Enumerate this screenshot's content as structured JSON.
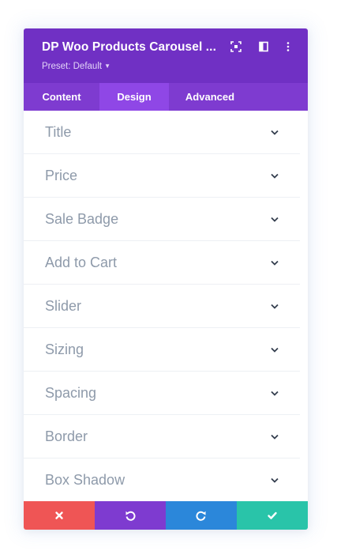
{
  "header": {
    "title": "DP Woo Products Carousel ...",
    "preset": "Preset: Default",
    "icons": [
      "focus-icon",
      "sidebar-layout-icon",
      "more-vertical-icon"
    ]
  },
  "tabs": [
    {
      "label": "Content",
      "active": false
    },
    {
      "label": "Design",
      "active": true
    },
    {
      "label": "Advanced",
      "active": false
    }
  ],
  "sections": [
    {
      "label": "Title"
    },
    {
      "label": "Price"
    },
    {
      "label": "Sale Badge"
    },
    {
      "label": "Add to Cart"
    },
    {
      "label": "Slider"
    },
    {
      "label": "Sizing"
    },
    {
      "label": "Spacing"
    },
    {
      "label": "Border"
    },
    {
      "label": "Box Shadow"
    }
  ],
  "footer": {
    "buttons": [
      {
        "name": "cancel",
        "icon": "close-icon",
        "color": "#ef5555"
      },
      {
        "name": "undo",
        "icon": "undo-icon",
        "color": "#7e3bd0"
      },
      {
        "name": "redo",
        "icon": "redo-icon",
        "color": "#2b87da"
      },
      {
        "name": "save",
        "icon": "check-icon",
        "color": "#29c4a9"
      }
    ]
  },
  "colors": {
    "header": "#7030c4",
    "tabs": "#7e3bd0",
    "active_tab": "#8f47e6",
    "section_text": "#8e9aaa"
  }
}
